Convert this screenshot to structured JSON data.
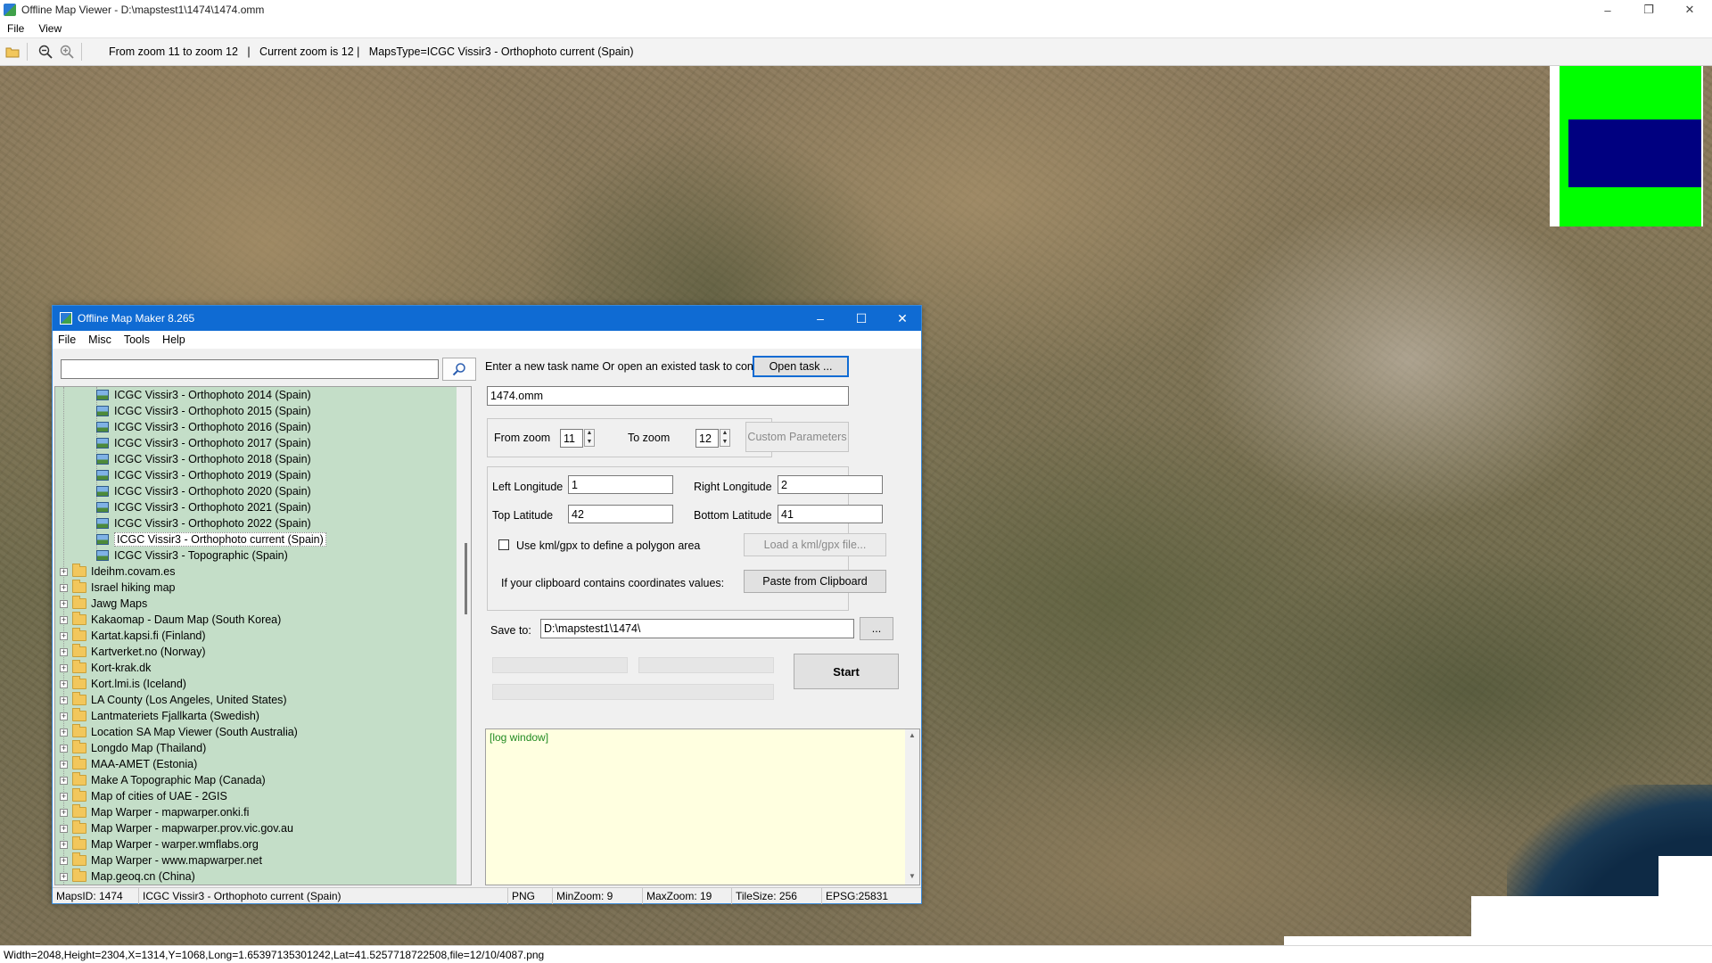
{
  "viewer": {
    "title": "Offline Map Viewer - D:\\mapstest1\\1474\\1474.omm",
    "menu": [
      "File",
      "View"
    ],
    "toolbar_text": "From zoom 11 to zoom 12   |   Current zoom is 12 |   MapsType=ICGC Vissir3 - Orthophoto current (Spain)",
    "status": "Width=2048,Height=2304,X=1314,Y=1068,Long=1.65397135301242,Lat=41.5257718722508,file=12/10/4087.png",
    "icons": [
      "open-folder-icon",
      "zoom-out-icon",
      "zoom-in-icon"
    ],
    "minimap_colors": {
      "outer": "#00ff00",
      "inner": "#000080"
    }
  },
  "maker": {
    "title": "Offline Map Maker 8.265",
    "menu": [
      "File",
      "Misc",
      "Tools",
      "Help"
    ],
    "search_placeholder": "",
    "tree_items": [
      {
        "label": "ICGC Vissir3 - Orthophoto 2014 (Spain)",
        "kind": "map"
      },
      {
        "label": "ICGC Vissir3 - Orthophoto 2015 (Spain)",
        "kind": "map"
      },
      {
        "label": "ICGC Vissir3 - Orthophoto 2016 (Spain)",
        "kind": "map"
      },
      {
        "label": "ICGC Vissir3 - Orthophoto 2017 (Spain)",
        "kind": "map"
      },
      {
        "label": "ICGC Vissir3 - Orthophoto 2018 (Spain)",
        "kind": "map"
      },
      {
        "label": "ICGC Vissir3 - Orthophoto 2019 (Spain)",
        "kind": "map"
      },
      {
        "label": "ICGC Vissir3 - Orthophoto 2020 (Spain)",
        "kind": "map"
      },
      {
        "label": "ICGC Vissir3 - Orthophoto 2021 (Spain)",
        "kind": "map"
      },
      {
        "label": "ICGC Vissir3 - Orthophoto 2022 (Spain)",
        "kind": "map"
      },
      {
        "label": "ICGC Vissir3 - Orthophoto current (Spain)",
        "kind": "map",
        "selected": true
      },
      {
        "label": "ICGC Vissir3 - Topographic (Spain)",
        "kind": "map"
      },
      {
        "label": "Ideihm.covam.es",
        "kind": "folder"
      },
      {
        "label": "Israel hiking map",
        "kind": "folder"
      },
      {
        "label": "Jawg Maps",
        "kind": "folder"
      },
      {
        "label": "Kakaomap - Daum Map (South Korea)",
        "kind": "folder"
      },
      {
        "label": "Kartat.kapsi.fi (Finland)",
        "kind": "folder"
      },
      {
        "label": "Kartverket.no (Norway)",
        "kind": "folder"
      },
      {
        "label": "Kort-krak.dk",
        "kind": "folder"
      },
      {
        "label": "Kort.lmi.is (Iceland)",
        "kind": "folder"
      },
      {
        "label": "LA County (Los Angeles, United States)",
        "kind": "folder"
      },
      {
        "label": "Lantmateriets Fjallkarta (Swedish)",
        "kind": "folder"
      },
      {
        "label": "Location SA Map Viewer (South Australia)",
        "kind": "folder"
      },
      {
        "label": "Longdo Map (Thailand)",
        "kind": "folder"
      },
      {
        "label": "MAA-AMET (Estonia)",
        "kind": "folder"
      },
      {
        "label": "Make A Topographic Map (Canada)",
        "kind": "folder"
      },
      {
        "label": "Map of cities of UAE - 2GIS",
        "kind": "folder"
      },
      {
        "label": "Map Warper - mapwarper.onki.fi",
        "kind": "folder"
      },
      {
        "label": "Map Warper - mapwarper.prov.vic.gov.au",
        "kind": "folder"
      },
      {
        "label": "Map Warper - warper.wmflabs.org",
        "kind": "folder"
      },
      {
        "label": "Map Warper - www.mapwarper.net",
        "kind": "folder"
      },
      {
        "label": "Map.geoq.cn (China)",
        "kind": "folder"
      }
    ],
    "form": {
      "task_prompt": "Enter a new task name Or open an existed task to continue:",
      "open_task_label": "Open task ...",
      "task_name": "1474.omm",
      "from_zoom_label": "From zoom",
      "from_zoom_value": "11",
      "to_zoom_label": "To zoom",
      "to_zoom_value": "12",
      "custom_params_label": "Custom Parameters",
      "left_lon_label": "Left Longitude",
      "left_lon_value": "1",
      "right_lon_label": "Right Longitude",
      "right_lon_value": "2",
      "top_lat_label": "Top Latitude",
      "top_lat_value": "42",
      "bottom_lat_label": "Bottom Latitude",
      "bottom_lat_value": "41",
      "kml_checkbox_label": "Use kml/gpx to define a polygon area",
      "kml_checked": false,
      "load_kml_label": "Load a kml/gpx file...",
      "clipboard_prompt": "If your clipboard contains coordinates values:",
      "paste_label": "Paste from Clipboard",
      "save_to_label": "Save to:",
      "save_to_value": "D:\\mapstest1\\1474\\",
      "browse_label": "...",
      "start_label": "Start"
    },
    "log_text": "[log window]",
    "status": {
      "maps_id": "MapsID: 1474",
      "maps_name": "ICGC Vissir3 - Orthophoto current (Spain)",
      "format": "PNG",
      "min_zoom": "MinZoom: 9",
      "max_zoom": "MaxZoom: 19",
      "tile_size": "TileSize: 256",
      "epsg": "EPSG:25831"
    }
  }
}
